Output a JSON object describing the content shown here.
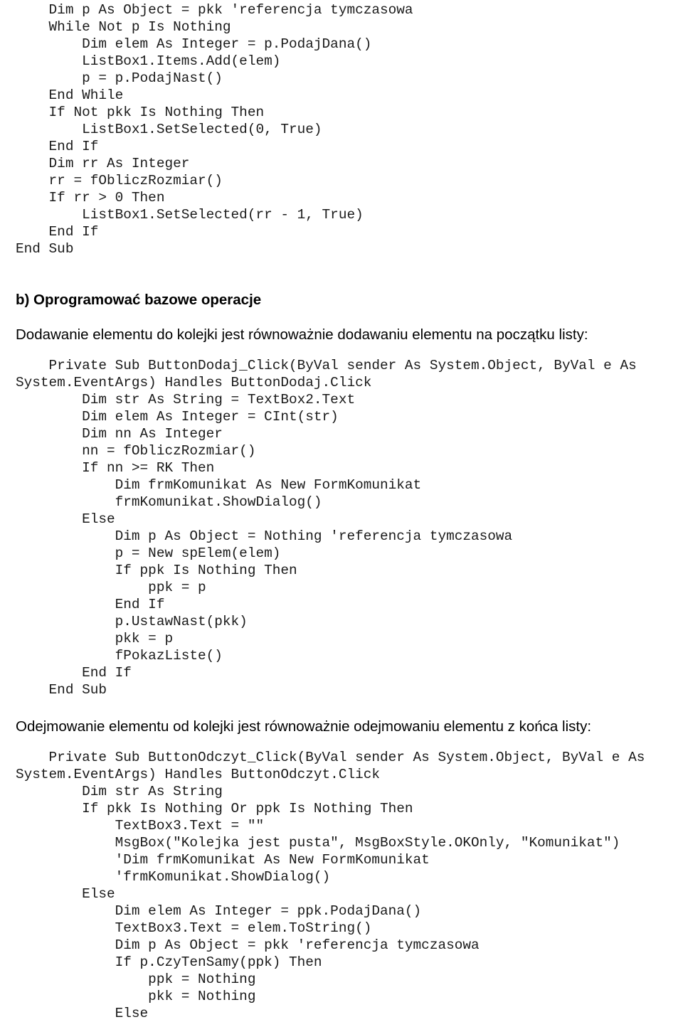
{
  "document": {
    "language": "pl",
    "code_blocks": {
      "block1_fpokazliste_tail": [
        "    Dim p As Object = pkk 'referencja tymczasowa",
        "    While Not p Is Nothing",
        "        Dim elem As Integer = p.PodajDana()",
        "        ListBox1.Items.Add(elem)",
        "        p = p.PodajNast()",
        "    End While",
        "    If Not pkk Is Nothing Then",
        "        ListBox1.SetSelected(0, True)",
        "    End If",
        "    Dim rr As Integer",
        "    rr = fObliczRozmiar()",
        "    If rr > 0 Then",
        "        ListBox1.SetSelected(rr - 1, True)",
        "    End If",
        "End Sub"
      ],
      "block2_button_dodaj": [
        "    Private Sub ButtonDodaj_Click(ByVal sender As System.Object, ByVal e As",
        "System.EventArgs) Handles ButtonDodaj.Click",
        "        Dim str As String = TextBox2.Text",
        "        Dim elem As Integer = CInt(str)",
        "        Dim nn As Integer",
        "        nn = fObliczRozmiar()",
        "        If nn >= RK Then",
        "            Dim frmKomunikat As New FormKomunikat",
        "            frmKomunikat.ShowDialog()",
        "        Else",
        "            Dim p As Object = Nothing 'referencja tymczasowa",
        "            p = New spElem(elem)",
        "            If ppk Is Nothing Then",
        "                ppk = p",
        "            End If",
        "            p.UstawNast(pkk)",
        "            pkk = p",
        "            fPokazListe()",
        "        End If",
        "    End Sub"
      ],
      "block3_button_odczyt": [
        "    Private Sub ButtonOdczyt_Click(ByVal sender As System.Object, ByVal e As",
        "System.EventArgs) Handles ButtonOdczyt.Click",
        "        Dim str As String",
        "        If pkk Is Nothing Or ppk Is Nothing Then",
        "            TextBox3.Text = \"\"",
        "            MsgBox(\"Kolejka jest pusta\", MsgBoxStyle.OKOnly, \"Komunikat\")",
        "            'Dim frmKomunikat As New FormKomunikat",
        "            'frmKomunikat.ShowDialog()",
        "        Else",
        "            Dim elem As Integer = ppk.PodajDana()",
        "            TextBox3.Text = elem.ToString()",
        "            Dim p As Object = pkk 'referencja tymczasowa",
        "            If p.CzyTenSamy(ppk) Then",
        "                ppk = Nothing",
        "                pkk = Nothing",
        "            Else"
      ]
    },
    "headings": {
      "section_b": "b) Oprogramować bazowe operacje"
    },
    "paragraphs": {
      "dodawanie": "Dodawanie elementu do kolejki jest równoważnie dodawaniu elementu na początku listy:",
      "odejmowanie": "Odejmowanie elementu od kolejki jest równoważnie odejmowaniu elementu z końca listy:"
    }
  }
}
